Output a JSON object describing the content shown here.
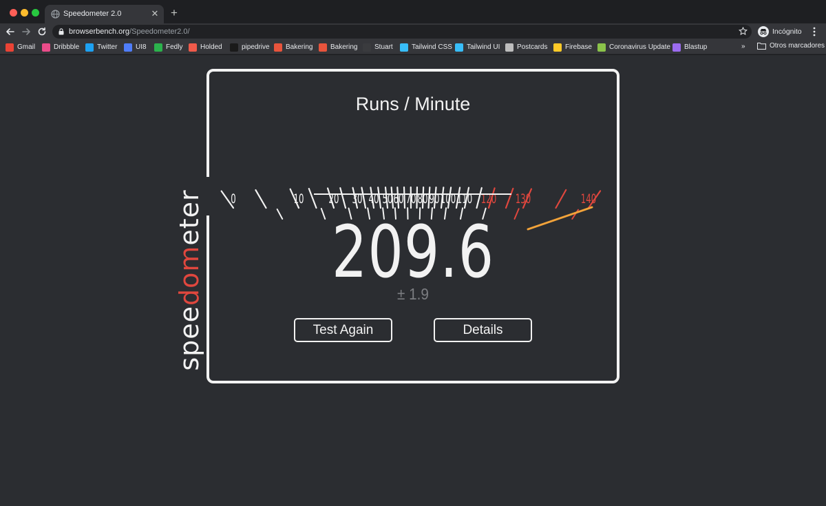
{
  "browser": {
    "tab": {
      "title": "Speedometer 2.0"
    },
    "address": {
      "host": "browserbench.org",
      "path": "/Speedometer2.0/"
    },
    "profile": {
      "label": "Incógnito"
    },
    "bookmarks": [
      {
        "label": "Gmail",
        "icon": "gmail-icon",
        "color": "#ea4335"
      },
      {
        "label": "Dribbble",
        "icon": "dribbble-icon",
        "color": "#ea4c89"
      },
      {
        "label": "Twitter",
        "icon": "twitter-icon",
        "color": "#1da1f2"
      },
      {
        "label": "UI8",
        "icon": "ui8-icon",
        "color": "#4f7dfa"
      },
      {
        "label": "Fedly",
        "icon": "fedly-icon",
        "color": "#2bb24c"
      },
      {
        "label": "Holded",
        "icon": "holded-icon",
        "color": "#f05a4a"
      },
      {
        "label": "pipedrive",
        "icon": "pipedrive-icon",
        "color": "#1a1a1a"
      },
      {
        "label": "Bakering",
        "icon": "bakering-icon",
        "color": "#e8543c"
      },
      {
        "label": "Bakering",
        "icon": "bakering-icon",
        "color": "#e8543c"
      },
      {
        "label": "Stuart",
        "icon": "stuart-icon",
        "color": "#3a3b3e"
      },
      {
        "label": "Tailwind CSS",
        "icon": "tailwind-icon",
        "color": "#38bdf8"
      },
      {
        "label": "Tailwind UI",
        "icon": "tailwind-icon",
        "color": "#38bdf8"
      },
      {
        "label": "Postcards",
        "icon": "postcards-icon",
        "color": "#bdbdbd"
      },
      {
        "label": "Firebase",
        "icon": "firebase-icon",
        "color": "#ffca28"
      },
      {
        "label": "Coronavirus Update",
        "icon": "coronavirus-update-icon",
        "color": "#8bc34a"
      },
      {
        "label": "Blastup",
        "icon": "blastup-icon",
        "color": "#9c6cf0"
      }
    ],
    "bookmarks_more": "»",
    "other_bookmarks": "Otros marcadores"
  },
  "speedometer": {
    "logo": {
      "prefix": "spee",
      "highlight": "dom",
      "suffix": "eter"
    },
    "title": "Runs / Minute",
    "gauge": {
      "labels": [
        "0",
        "10",
        "20",
        "30",
        "40",
        "50",
        "60",
        "70",
        "80",
        "90",
        "100",
        "110",
        "120",
        "130",
        "140"
      ],
      "red_from": 120,
      "colors": {
        "normal": "#f2f2f2",
        "red": "#e0473e",
        "needle": "#f2a33a"
      }
    },
    "score": "209.6",
    "error": "± 1.9",
    "buttons": {
      "test_again": "Test Again",
      "details": "Details"
    }
  }
}
